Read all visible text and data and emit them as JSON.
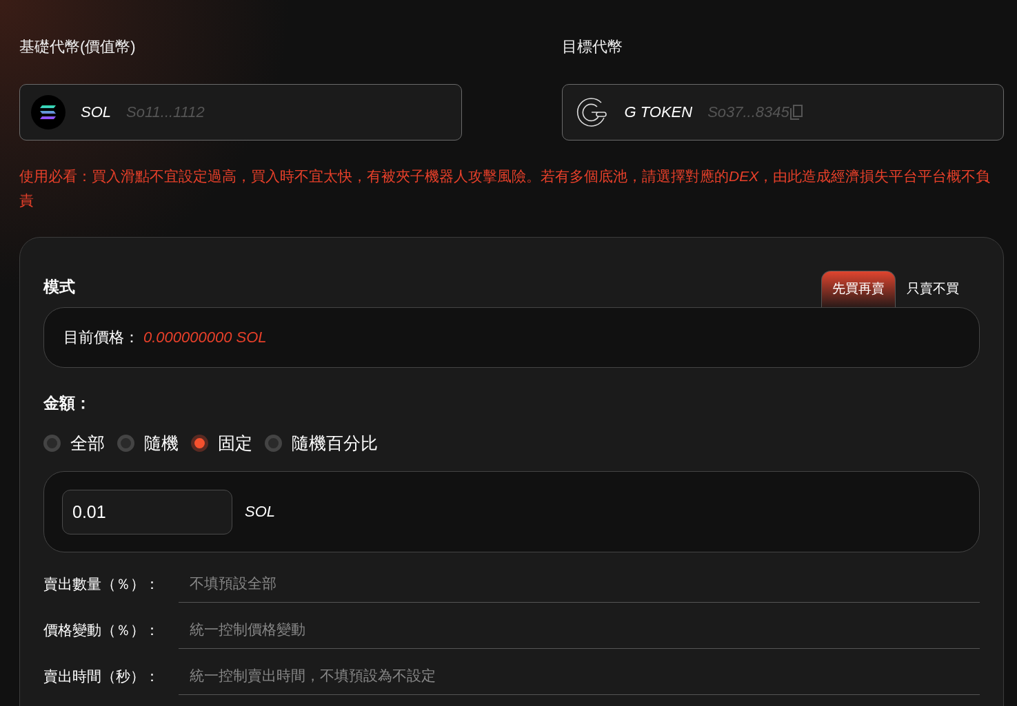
{
  "base": {
    "label": "基礎代幣(價值幣)",
    "symbol": "SOL",
    "address": "So11...1112"
  },
  "target": {
    "label": "目標代幣",
    "symbol": "G TOKEN",
    "address": "So37...8345"
  },
  "warning": [
    {
      "text": "使用必看：買入滑點不宜設定過高，買入時不宜太快，有被夾子機器人攻擊風險。若有多個底池，請選擇對應的",
      "italic": false
    },
    {
      "text": "DEX",
      "italic": true
    },
    {
      "text": "，由此造成經濟損失平台平台概不負責",
      "italic": false
    }
  ],
  "mode": {
    "title": "模式",
    "tabs": [
      {
        "label": "先買再賣",
        "selected": true
      },
      {
        "label": "只賣不買",
        "selected": false
      }
    ],
    "price_label": "目前價格：",
    "price": "0.000000000 SOL"
  },
  "amount": {
    "title": "金額：",
    "options": [
      {
        "label": "全部",
        "selected": false
      },
      {
        "label": "隨機",
        "selected": false
      },
      {
        "label": "固定",
        "selected": true
      },
      {
        "label": "隨機百分比",
        "selected": false
      }
    ],
    "value": "0.01",
    "unit": "SOL"
  },
  "fields": [
    {
      "label": "賣出數量（％）：",
      "placeholder": "不填預設全部"
    },
    {
      "label": "價格變動（％）：",
      "placeholder": "統一控制價格變動"
    },
    {
      "label": "賣出時間（秒）：",
      "placeholder": "統一控制賣出時間，不填預設為不設定"
    }
  ]
}
